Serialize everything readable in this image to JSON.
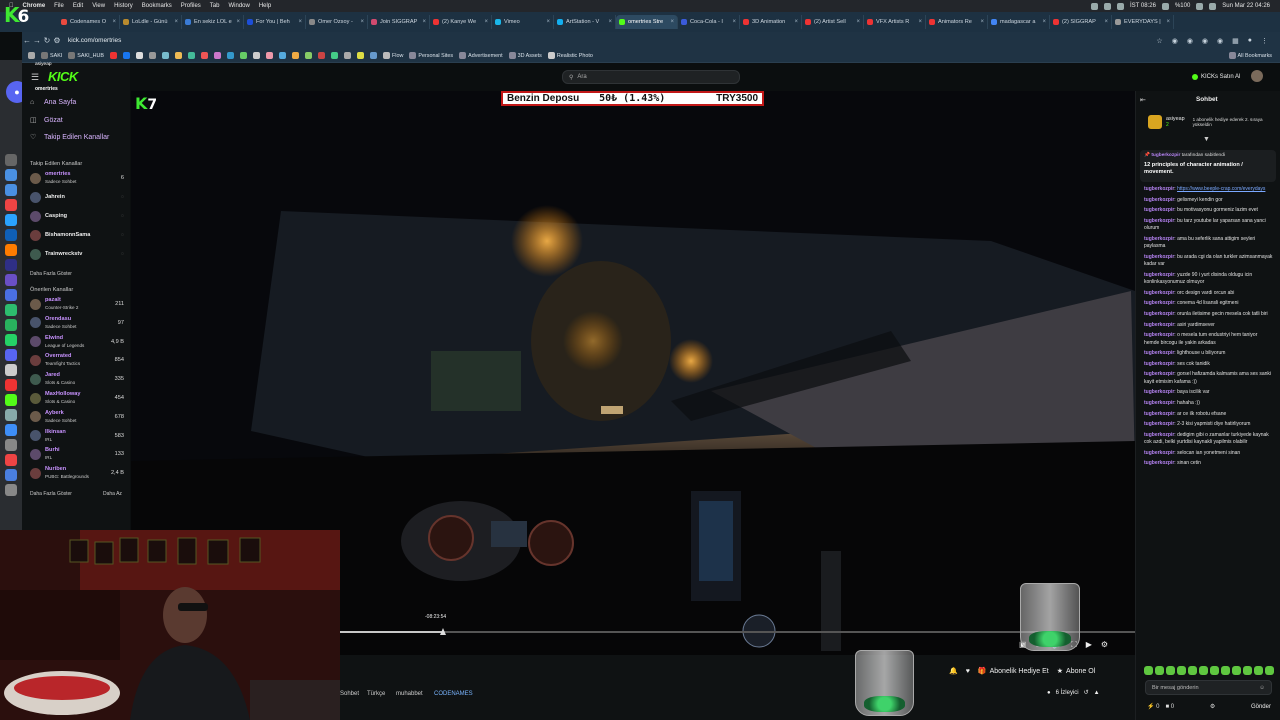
{
  "menubar": {
    "app": "Chrome",
    "items": [
      "File",
      "Edit",
      "View",
      "History",
      "Bookmarks",
      "Profiles",
      "Tab",
      "Window",
      "Help"
    ],
    "time_left": "İST 08:26",
    "battery": "%100",
    "datetime": "Sun Mar 22  04:26"
  },
  "tabs": [
    {
      "label": "Codenames O",
      "color": "#e94a3f"
    },
    {
      "label": "LoLdle - Günü",
      "color": "#b88a2e"
    },
    {
      "label": "En sekiz LOL e",
      "color": "#3a7bd5"
    },
    {
      "label": "For You | Beh",
      "color": "#1d4ed8"
    },
    {
      "label": "Omer Ozsoy -",
      "color": "#888888"
    },
    {
      "label": "Join SIGGRAP",
      "color": "#d14a6f"
    },
    {
      "label": "(2) Kanye We",
      "color": "#e33"
    },
    {
      "label": "Vimeo",
      "color": "#1ab7ea"
    },
    {
      "label": "ArtStation - V",
      "color": "#13aff0"
    },
    {
      "label": "omertries Stre",
      "color": "#53fc18",
      "active": true
    },
    {
      "label": "Coca-Cola - I",
      "color": "#3b5bdb"
    },
    {
      "label": "3D Animation",
      "color": "#e33"
    },
    {
      "label": "(2) Artist Sell",
      "color": "#e33"
    },
    {
      "label": "VFX Artists R",
      "color": "#e33"
    },
    {
      "label": "Animators Re",
      "color": "#e33"
    },
    {
      "label": "madagascar a",
      "color": "#4285f4"
    },
    {
      "label": "(2) SIGGRAP",
      "color": "#e33"
    },
    {
      "label": "EVERYDAYS |",
      "color": "#999"
    }
  ],
  "brand_mark": {
    "k": "K",
    "num": "6"
  },
  "address": {
    "url": "kick.com/omertries"
  },
  "bookmarks": {
    "named": [
      "SAKI",
      "SAKI_HUB",
      "Flow",
      "Personal Sites",
      "Advertisement",
      "3D Assets",
      "Realistic Photo"
    ],
    "all": "All Bookmarks"
  },
  "kick": {
    "logo": "KICK",
    "user_small": "asiyeap",
    "user_main": "omertries",
    "search_placeholder": "Ara",
    "kicks_label": "KICKs Satın Al",
    "nav": [
      {
        "label": "Ana Sayfa",
        "icon": "home-icon"
      },
      {
        "label": "Gözat",
        "icon": "browse-icon"
      },
      {
        "label": "Takip Edilen Kanallar",
        "icon": "heart-icon"
      }
    ],
    "followed_header": "Takip Edilen Kanallar",
    "followed": [
      {
        "name": "omertries",
        "category": "Sadece Sohbet",
        "count": "6",
        "live": true
      },
      {
        "name": "Jahrein",
        "category": "",
        "count": "",
        "live": false
      },
      {
        "name": "Casping",
        "category": "",
        "count": "",
        "live": false
      },
      {
        "name": "BishamonnSama",
        "category": "",
        "count": "",
        "live": false
      },
      {
        "name": "Trainwreckstv",
        "category": "",
        "count": "",
        "live": false
      }
    ],
    "show_more": "Daha Fazla Göster",
    "recommended_header": "Önerilen Kanallar",
    "recommended": [
      {
        "name": "pazalt",
        "category": "Counter-Strike 2",
        "count": "211"
      },
      {
        "name": "Orendasu",
        "category": "Sadece Sohbet",
        "count": "97"
      },
      {
        "name": "Elwind",
        "category": "League of Legends",
        "count": "4,9 B"
      },
      {
        "name": "Overrated",
        "category": "Teamfight Tactics",
        "count": "854"
      },
      {
        "name": "Jared",
        "category": "Slots & Casino",
        "count": "335"
      },
      {
        "name": "MaxHolloway",
        "category": "Slots & Casino",
        "count": "454"
      },
      {
        "name": "Ayberk",
        "category": "Sadece Sohbet",
        "count": "678"
      },
      {
        "name": "Ilkinsan",
        "category": "IRL",
        "count": "583"
      },
      {
        "name": "Burhi",
        "category": "IRL",
        "count": "133"
      },
      {
        "name": "Nuriben",
        "category": "PUBG: Battlegrounds",
        "count": "2,4 B"
      }
    ],
    "show_more2": "Daha Fazla Göster",
    "show_less": "Daha Az"
  },
  "video": {
    "watermark": {
      "k": "K",
      "num": "7"
    },
    "banner": {
      "label": "Benzin Deposu",
      "progress": "50₺ (1.43%)",
      "target": "TRY3500"
    },
    "time_tooltip": "-08:23:54",
    "progress_fraction": 0.13
  },
  "below": {
    "tags": [
      "Sohbet",
      "Türkçe",
      "muhabbet",
      "CODENAMES"
    ],
    "gift_label": "Abonelik Hediye Et",
    "subscribe_label": "Abone Ol",
    "viewers": "6 İzleyici"
  },
  "chat": {
    "title": "Sohbet",
    "gifter": {
      "name": "asiyeap",
      "count": "2",
      "message": "1 abonelik hediye ederek 2. sıraya yükseldin"
    },
    "pinned": {
      "author": "tugberkozpir",
      "suffix": " tarafından sabitlendi",
      "text": "12 principles of character animation / movement."
    },
    "messages": [
      {
        "user": "tugberkozpir",
        "text": "",
        "link": "https://www.beeple-crap.com/everydays"
      },
      {
        "user": "tugberkozpir",
        "text": "gelismeyi kendin gor"
      },
      {
        "user": "tugberkozpir",
        "text": "bu motivasyonu gormeniz lazim evet"
      },
      {
        "user": "tugberkozpir",
        "text": "bu tarz youtube lar yaparsan sana yanci olurum"
      },
      {
        "user": "tugberkozpir",
        "text": "ama bu seferlik sana attigim seyleri paylasma"
      },
      {
        "user": "tugberkozpir",
        "text": "bu arada cgi da olan turkler azimsanmayak kadar var"
      },
      {
        "user": "tugberkozpir",
        "text": "yuzde 90 i yurt disinda oldugu icin konlinkasyonumuz olmuyor"
      },
      {
        "user": "tugberkozpir",
        "text": "orc design vardi orcun abi"
      },
      {
        "user": "tugberkozpir",
        "text": "conema 4d lisansli egitmeni"
      },
      {
        "user": "tugberkozpir",
        "text": "orunla iletisime gecin mesela cok tatli biri"
      },
      {
        "user": "tugberkozpir",
        "text": "asiri yardimsever"
      },
      {
        "user": "tugberkozpir",
        "text": "o mesela tum endustriyi hem taniyor hemde bircogu ile yakin arkadas"
      },
      {
        "user": "tugberkozpir",
        "text": "lighthouse u biliyorum"
      },
      {
        "user": "tugberkozpir",
        "text": "ses cok tanidik"
      },
      {
        "user": "tugberkozpir",
        "text": "gorsel hafizamda kalmamis ama ses sanki kayit etmisim kafama :))"
      },
      {
        "user": "tugberkozpir",
        "text": "baya iscilik var"
      },
      {
        "user": "tugberkozpir",
        "text": "hahaha :))"
      },
      {
        "user": "tugberkozpir",
        "text": "ar ce ilk robotu efsane"
      },
      {
        "user": "tugberkozpir",
        "text": "2-3 kisi yapmisti diye hatirliyorum"
      },
      {
        "user": "tugberkozpir",
        "text": "dedigim gibi o zamanlar turkiyede kaynak cok azdi, belki yurtdisi kaynakli yapilmis olabilir"
      },
      {
        "user": "tugberkozpir",
        "text": "selocan ian yonetmeni sinan"
      },
      {
        "user": "tugberkozpir",
        "text": "sinan cetin"
      }
    ],
    "input_placeholder": "Bir mesaj gönderin",
    "kicks_count": "0",
    "points_count": "0",
    "send": "Gönder"
  },
  "colors": {
    "kick_green": "#53fc18",
    "accent_purple": "#b784f5",
    "chrome_tab_bg": "#1d3142"
  }
}
